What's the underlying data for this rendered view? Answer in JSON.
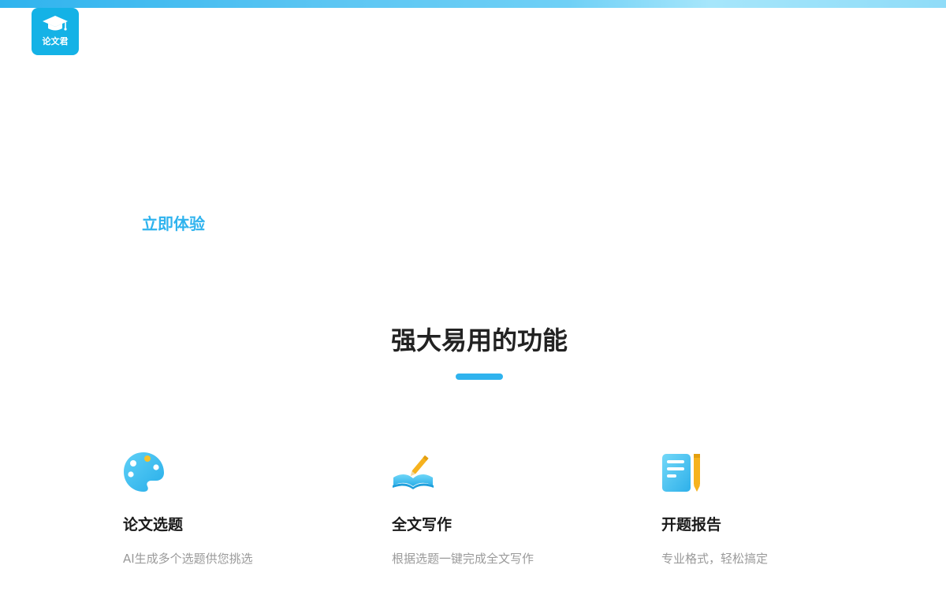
{
  "brand": {
    "logo_text": "论文君",
    "color": "#14b2e6"
  },
  "hero": {
    "cta_label": "立即体验"
  },
  "features_section": {
    "title": "强大易用的功能",
    "accent_color": "#2fb3ee",
    "items": [
      {
        "icon": "palette-icon",
        "title": "论文选题",
        "description": "AI生成多个选题供您挑选"
      },
      {
        "icon": "open-book-pencil-icon",
        "title": "全文写作",
        "description": "根据选题一键完成全文写作"
      },
      {
        "icon": "document-pencil-icon",
        "title": "开题报告",
        "description": "专业格式，轻松搞定"
      }
    ]
  }
}
